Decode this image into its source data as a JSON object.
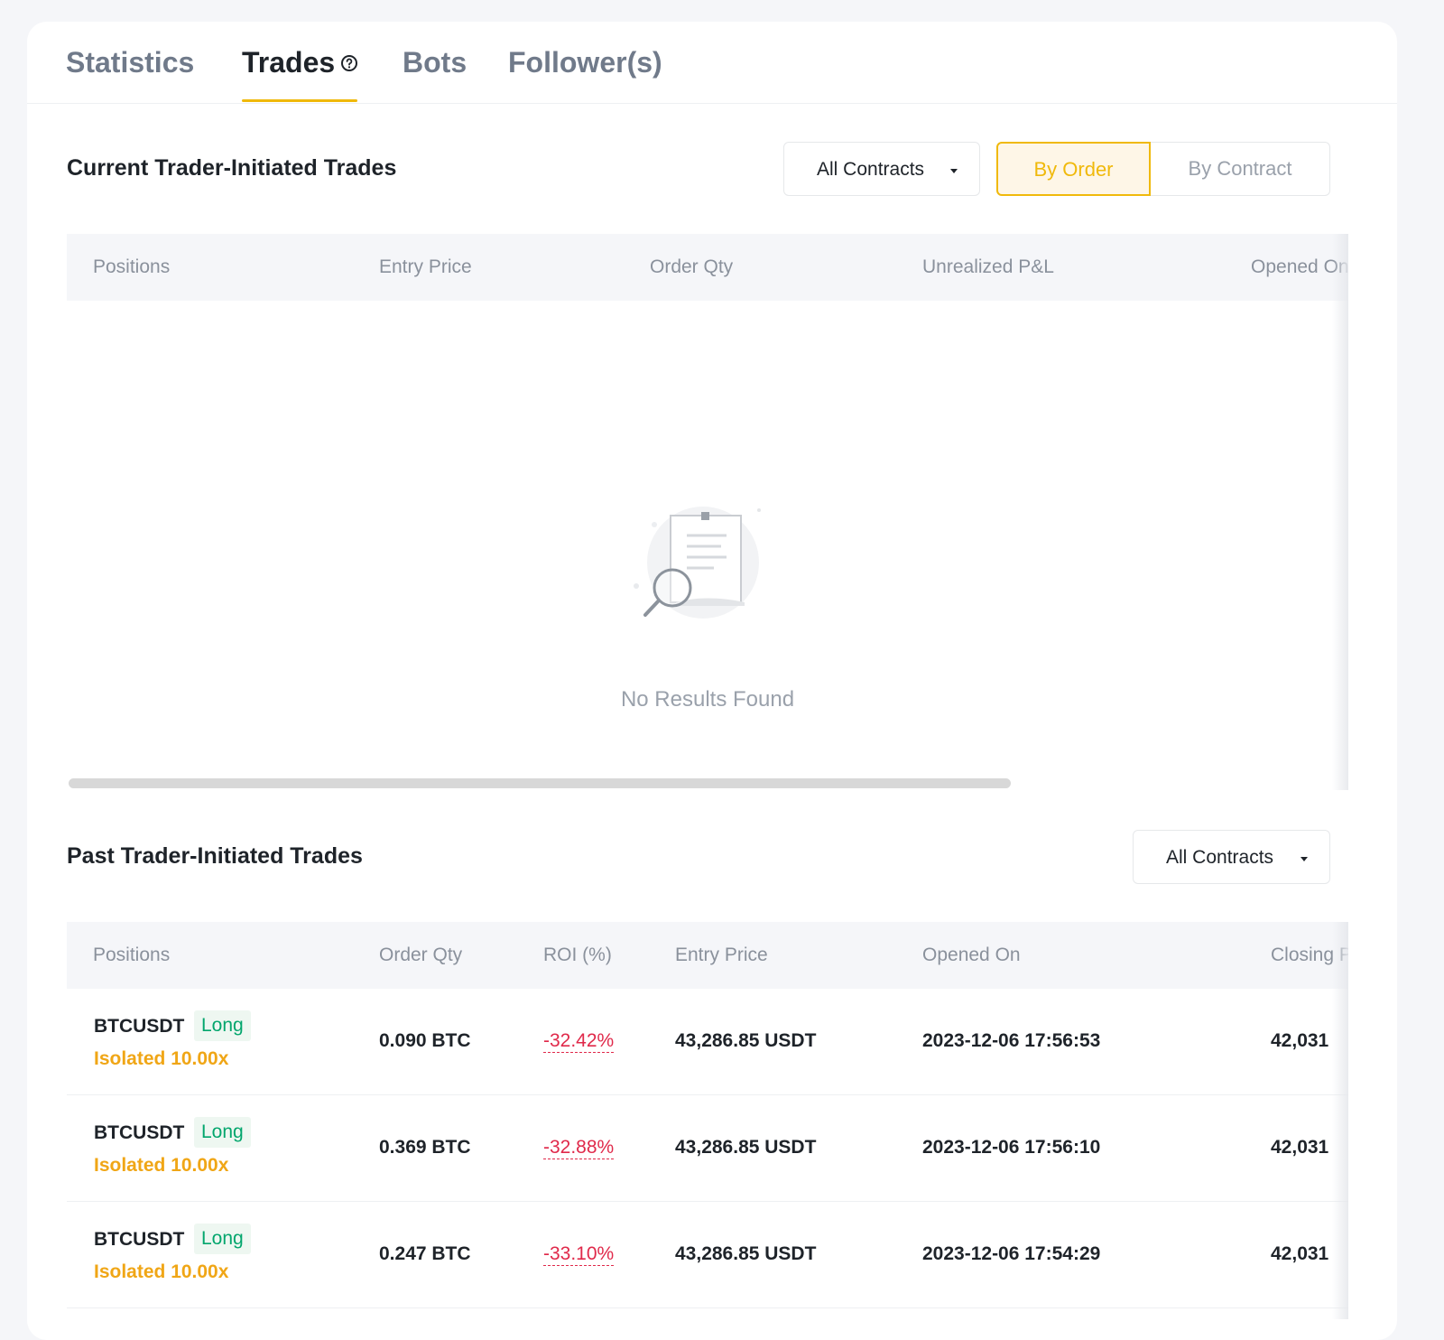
{
  "tabs": [
    {
      "label": "Statistics",
      "active": false
    },
    {
      "label": "Trades",
      "active": true
    },
    {
      "label": "Bots",
      "active": false
    },
    {
      "label": "Follower(s)",
      "active": false
    }
  ],
  "current": {
    "title": "Current Trader-Initiated Trades",
    "filter": "All Contracts",
    "toggle": {
      "by_order": "By Order",
      "by_contract": "By Contract",
      "selected": "By Order"
    },
    "columns": [
      "Positions",
      "Entry Price",
      "Order Qty",
      "Unrealized P&L",
      "Opened On"
    ],
    "empty_text": "No Results Found"
  },
  "past": {
    "title": "Past Trader-Initiated Trades",
    "filter": "All Contracts",
    "columns": [
      "Positions",
      "Order Qty",
      "ROI (%)",
      "Entry Price",
      "Opened On",
      "Closing Price"
    ],
    "rows": [
      {
        "symbol": "BTCUSDT",
        "side": "Long",
        "leverage": "Isolated 10.00x",
        "qty": "0.090 BTC",
        "roi": "-32.42%",
        "entry": "43,286.85 USDT",
        "opened": "2023-12-06 17:56:53",
        "closing": "42,031"
      },
      {
        "symbol": "BTCUSDT",
        "side": "Long",
        "leverage": "Isolated 10.00x",
        "qty": "0.369 BTC",
        "roi": "-32.88%",
        "entry": "43,286.85 USDT",
        "opened": "2023-12-06 17:56:10",
        "closing": "42,031"
      },
      {
        "symbol": "BTCUSDT",
        "side": "Long",
        "leverage": "Isolated 10.00x",
        "qty": "0.247 BTC",
        "roi": "-33.10%",
        "entry": "43,286.85 USDT",
        "opened": "2023-12-06 17:54:29",
        "closing": "42,031"
      }
    ]
  },
  "colors": {
    "accent": "#f0b90b",
    "long": "#03a66d",
    "loss": "#e0294a",
    "leverage": "#f0a616"
  },
  "icons": {
    "help": "question-circle-icon",
    "dropdown": "caret-down-icon",
    "empty": "document-search-icon"
  }
}
